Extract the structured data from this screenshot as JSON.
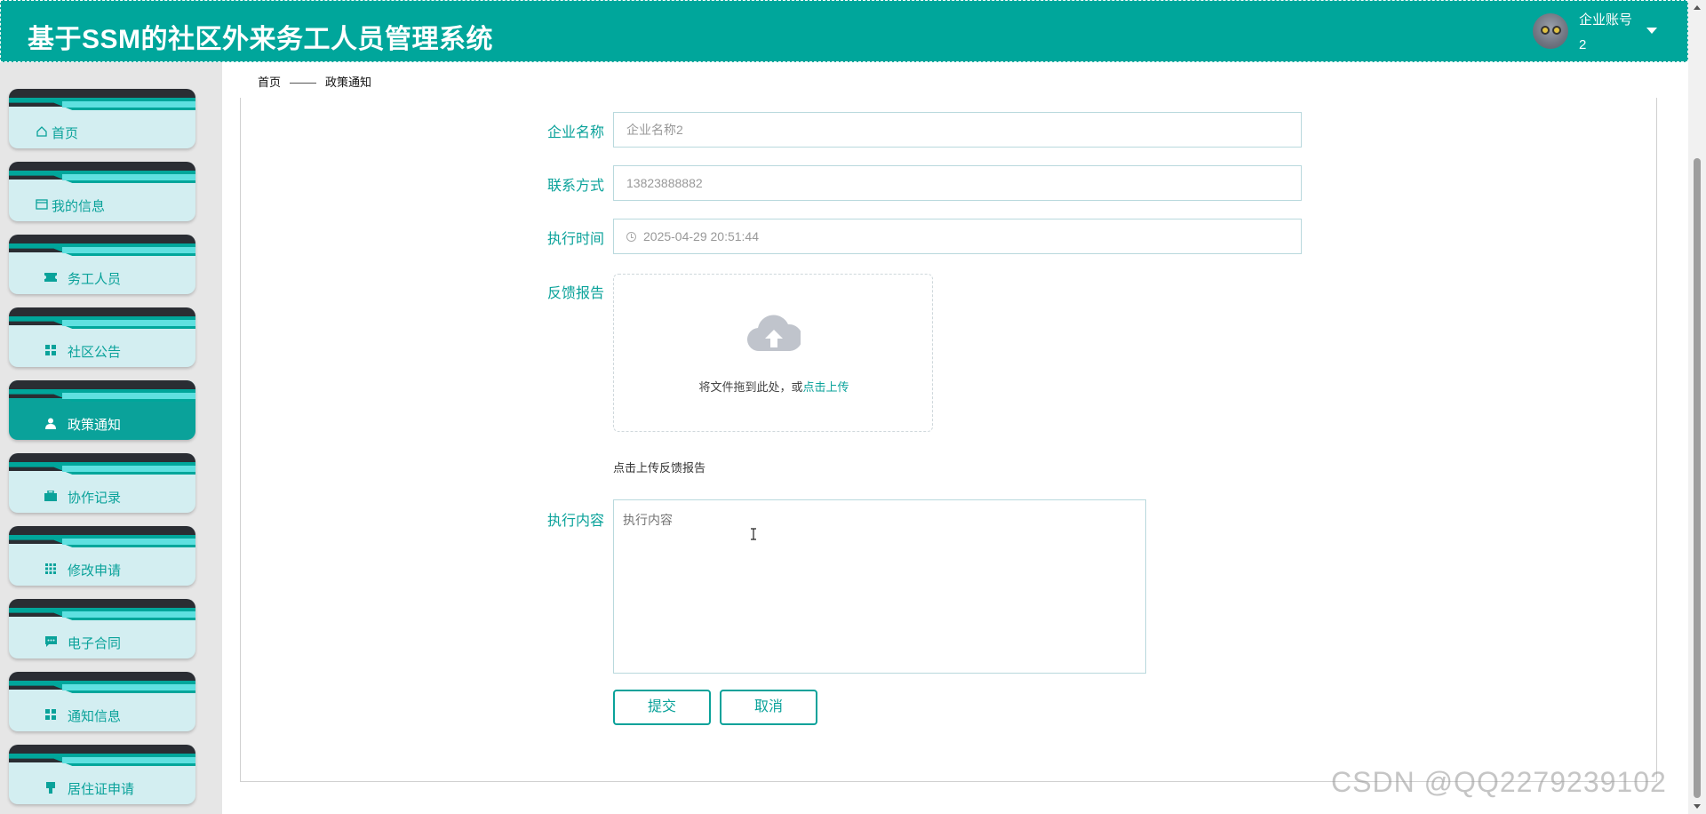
{
  "header": {
    "title": "基于SSM的社区外来务工人员管理系统",
    "user_name": "企业账号",
    "user_num": "2",
    "bg_color": "#00a69b"
  },
  "sidebar": {
    "items": [
      {
        "label": "首页",
        "icon": "home-icon"
      },
      {
        "label": "我的信息",
        "icon": "card-icon"
      },
      {
        "label": "务工人员",
        "icon": "ticket-icon"
      },
      {
        "label": "社区公告",
        "icon": "grid-icon"
      },
      {
        "label": "政策通知",
        "icon": "person-icon",
        "active": true
      },
      {
        "label": "协作记录",
        "icon": "briefcase-icon"
      },
      {
        "label": "修改申请",
        "icon": "apps-icon"
      },
      {
        "label": "电子合同",
        "icon": "message-icon"
      },
      {
        "label": "通知信息",
        "icon": "grid-icon"
      },
      {
        "label": "居住证申请",
        "icon": "stamp-icon"
      }
    ]
  },
  "breadcrumb": {
    "home": "首页",
    "current": "政策通知"
  },
  "form": {
    "company_label": "企业名称",
    "company_value": "企业名称2",
    "contact_label": "联系方式",
    "contact_value": "13823888882",
    "time_label": "执行时间",
    "time_value": "2025-04-29 20:51:44",
    "report_label": "反馈报告",
    "upload_text": "将文件拖到此处，或",
    "upload_link": "点击上传",
    "upload_hint": "点击上传反馈报告",
    "content_label": "执行内容",
    "content_placeholder": "执行内容"
  },
  "buttons": {
    "submit": "提交",
    "cancel": "取消"
  },
  "watermark": "CSDN @QQ2279239102",
  "colors": {
    "accent": "#0aa29a",
    "nav_bg": "#d3eef1",
    "nav_cap": "#2a2d33",
    "nav_stripe": "#5fe0e0"
  }
}
